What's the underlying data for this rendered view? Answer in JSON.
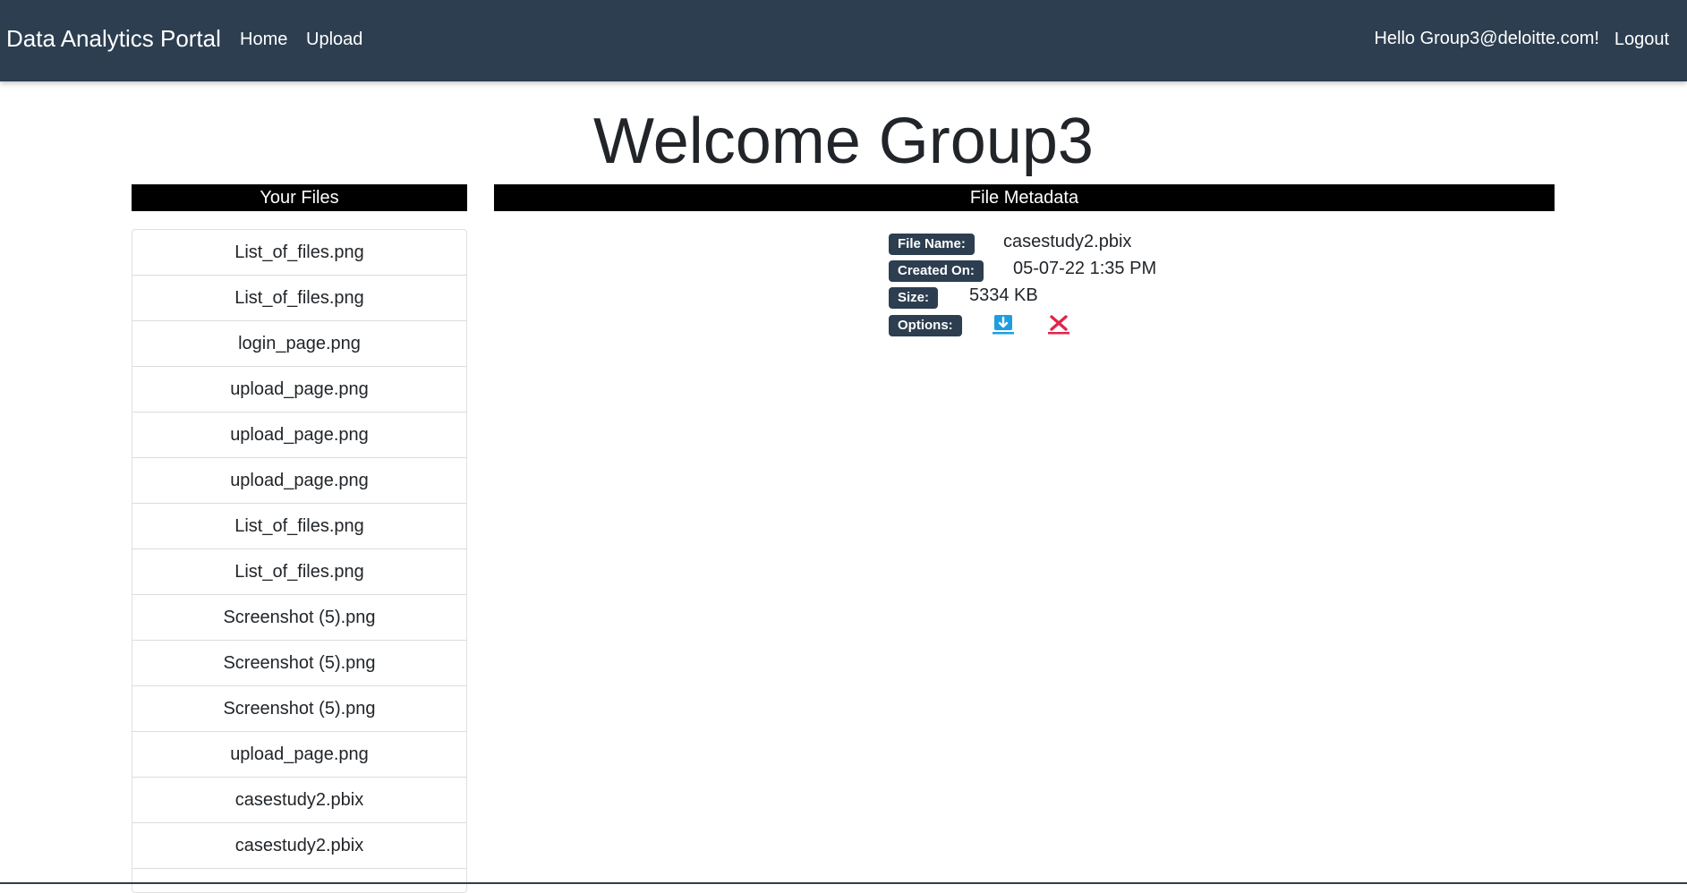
{
  "navbar": {
    "brand": "Data Analytics Portal",
    "links": [
      "Home",
      "Upload"
    ],
    "greeting": "Hello Group3@deloitte.com!",
    "logout": "Logout",
    "bg_color": "#2c3e50"
  },
  "page": {
    "title": "Welcome Group3"
  },
  "files_panel": {
    "header": "Your Files",
    "files": [
      "List_of_files.png",
      "List_of_files.png",
      "login_page.png",
      "upload_page.png",
      "upload_page.png",
      "upload_page.png",
      "List_of_files.png",
      "List_of_files.png",
      "Screenshot (5).png",
      "Screenshot (5).png",
      "Screenshot (5).png",
      "upload_page.png",
      "casestudy2.pbix",
      "casestudy2.pbix",
      ""
    ]
  },
  "metadata_panel": {
    "header": "File Metadata",
    "file_name_label": "File Name:",
    "file_name_value": "casestudy2.pbix",
    "created_label": "Created On:",
    "created_value": "05-07-22 1:35 PM",
    "size_label": "Size:",
    "size_value": "5334 KB",
    "options_label": "Options:",
    "icons": [
      "download-icon",
      "delete-icon"
    ],
    "download_color": "#1e9ee0",
    "delete_color": "#e0264a"
  }
}
